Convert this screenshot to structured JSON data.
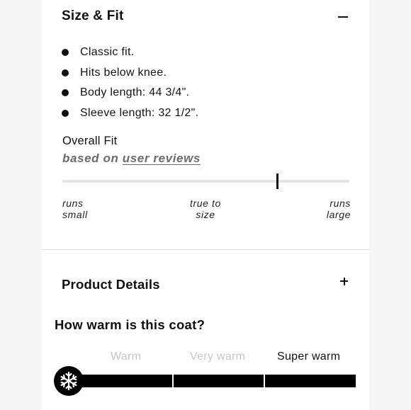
{
  "size_fit": {
    "title": "Size & Fit",
    "toggle_icon": "minus-icon",
    "bullets": [
      "Classic fit.",
      "Hits below knee.",
      "Body length: 44 3/4\".",
      "Sleeve length: 32 1/2\"."
    ],
    "overall_fit_label": "Overall Fit",
    "based_on_prefix": "based on",
    "based_on_link": "user reviews",
    "fit_position_fraction": 0.75,
    "scale_labels": {
      "left_line1": "runs",
      "left_line2": "small",
      "center_line1": "true to",
      "center_line2": "size",
      "right_line1": "runs",
      "right_line2": "large"
    }
  },
  "product_details": {
    "title": "Product Details",
    "toggle_icon": "plus-icon"
  },
  "warmth": {
    "question": "How warm is this coat?",
    "levels": [
      "Warm",
      "Very warm",
      "Super warm"
    ],
    "selected_level": "Super warm",
    "icon": "snowflake-icon",
    "colors": {
      "active": "#111111",
      "inactive": "#c6c6c6",
      "bar": "#000000"
    }
  }
}
